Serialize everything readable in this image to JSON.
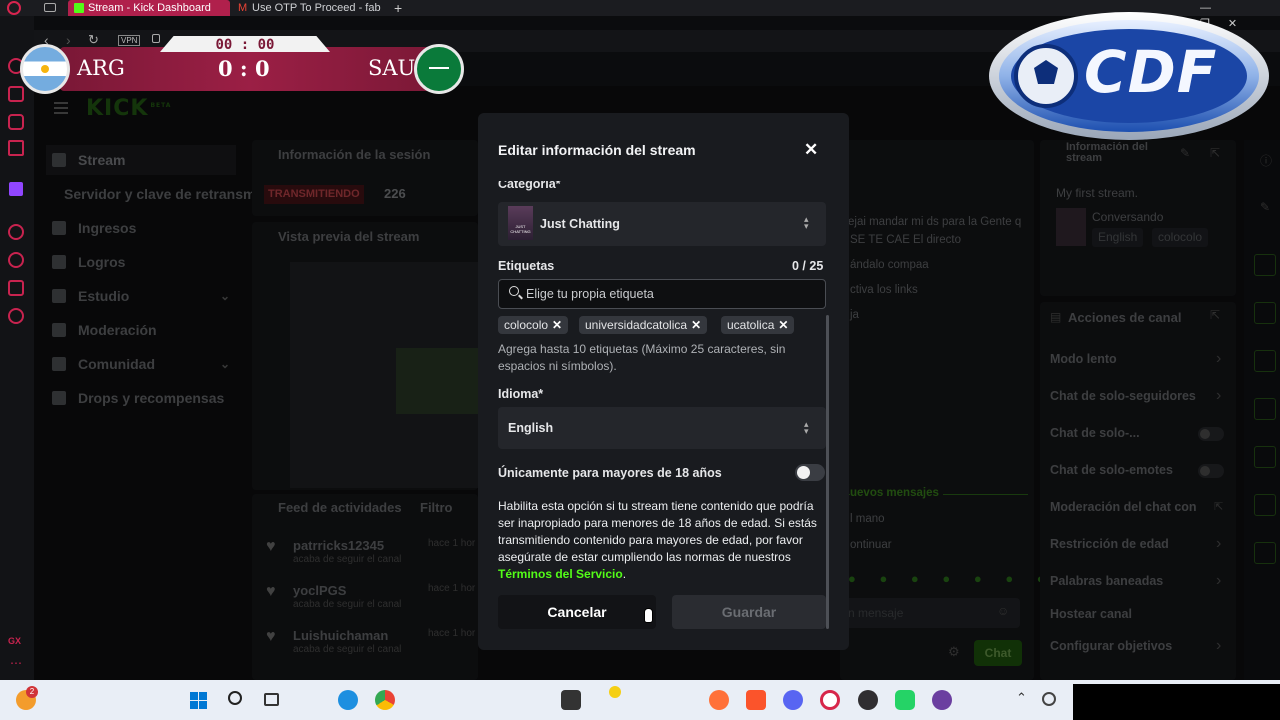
{
  "browser": {
    "tabs": [
      {
        "label": "Stream - Kick Dashboard",
        "active": true
      },
      {
        "label": "Use OTP To Proceed - fab",
        "active": false
      }
    ],
    "vpn_label": "VPN"
  },
  "scoreboard": {
    "time": "00 : 00",
    "home": "ARG",
    "away": "SAU",
    "score": "0 : 0"
  },
  "overlay_logo": {
    "text": "CDF"
  },
  "dashboard": {
    "logo": "KICK",
    "logo_badge": "BETA",
    "nav": [
      {
        "label": "Stream",
        "active": true
      },
      {
        "label": "Servidor y clave de retransm",
        "active": false
      },
      {
        "label": "Ingresos"
      },
      {
        "label": "Logros"
      },
      {
        "label": "Estudio",
        "has_chevron": true
      },
      {
        "label": "Moderación"
      },
      {
        "label": "Comunidad",
        "has_chevron": true
      },
      {
        "label": "Drops y recompensas"
      }
    ],
    "session": {
      "title": "Información de la sesión",
      "status_badge": "TRANSMITIENDO",
      "viewers": "226"
    },
    "preview": {
      "title": "Vista previa del stream"
    },
    "feed": {
      "title": "Feed de actividades",
      "filter": "Filtro",
      "items": [
        {
          "user": "patrricks12345",
          "action": "acaba de seguir el canal",
          "time": "hace 1 hor"
        },
        {
          "user": "yoclPGS",
          "action": "acaba de seguir el canal",
          "time": "hace 1 hor"
        },
        {
          "user": "Luishuichaman",
          "action": "acaba de seguir el canal",
          "time": "hace 1 hor"
        }
      ]
    },
    "chat": {
      "lines": [
        "ejai mandar mi ds para la Gente q",
        "SE TE CAE El directo",
        "ándalo compaa",
        "ctiva los links",
        "ja"
      ],
      "new_messages": "uevos mensajes",
      "below_lines": [
        "l mano",
        "ontinuar"
      ],
      "input_placeholder": "n mensaje",
      "send": "Chat"
    },
    "stream_info": {
      "title": "Información del stream",
      "stream_title": "My first stream.",
      "category": "Conversando",
      "tags": [
        "English",
        "colocolo"
      ]
    },
    "actions": {
      "title": "Acciones de canal",
      "items": [
        {
          "label": "Modo lento",
          "type": "chevron"
        },
        {
          "label": "Chat de solo-seguidores",
          "type": "chevron"
        },
        {
          "label": "Chat de solo-...",
          "type": "toggle"
        },
        {
          "label": "Chat de solo-emotes",
          "type": "toggle"
        },
        {
          "label": "Moderación del chat con IA",
          "type": "external"
        },
        {
          "label": "Restricción de edad",
          "type": "chevron"
        },
        {
          "label": "Palabras baneadas",
          "type": "chevron"
        },
        {
          "label": "Hostear canal",
          "type": "none"
        },
        {
          "label": "Configurar objetivos",
          "type": "chevron"
        }
      ]
    }
  },
  "modal": {
    "title": "Editar información del stream",
    "category_label": "Categoría*",
    "category_value": "Just Chatting",
    "category_thumb_text": "JUST CHATTING",
    "tags_label": "Etiquetas",
    "tags_count": "0 / 25",
    "tags_placeholder": "Elige tu propia etiqueta",
    "tags": [
      "colocolo",
      "universidadcatolica",
      "ucatolica"
    ],
    "tags_help": "Agrega hasta 10 etiquetas (Máximo 25 caracteres, sin espacios ni símbolos).",
    "language_label": "Idioma*",
    "language_value": "English",
    "adult_label": "Únicamente para mayores de 18 años",
    "adult_enabled": false,
    "adult_desc": "Habilita esta opción si tu stream tiene contenido que podría ser inapropiado para menores de 18 años de edad. Si estás transmitiendo contenido para mayores de edad, por favor asegúrate de estar cumpliendo las normas de nuestros",
    "terms_link": "Términos del Servicio",
    "terms_after": ".",
    "cancel": "Cancelar",
    "save": "Guardar"
  },
  "taskbar": {
    "notification_badge": "2"
  },
  "colors": {
    "kick_green": "#53fc18",
    "accent_red": "#c8234f",
    "scoreboard": "#9b1f45"
  }
}
